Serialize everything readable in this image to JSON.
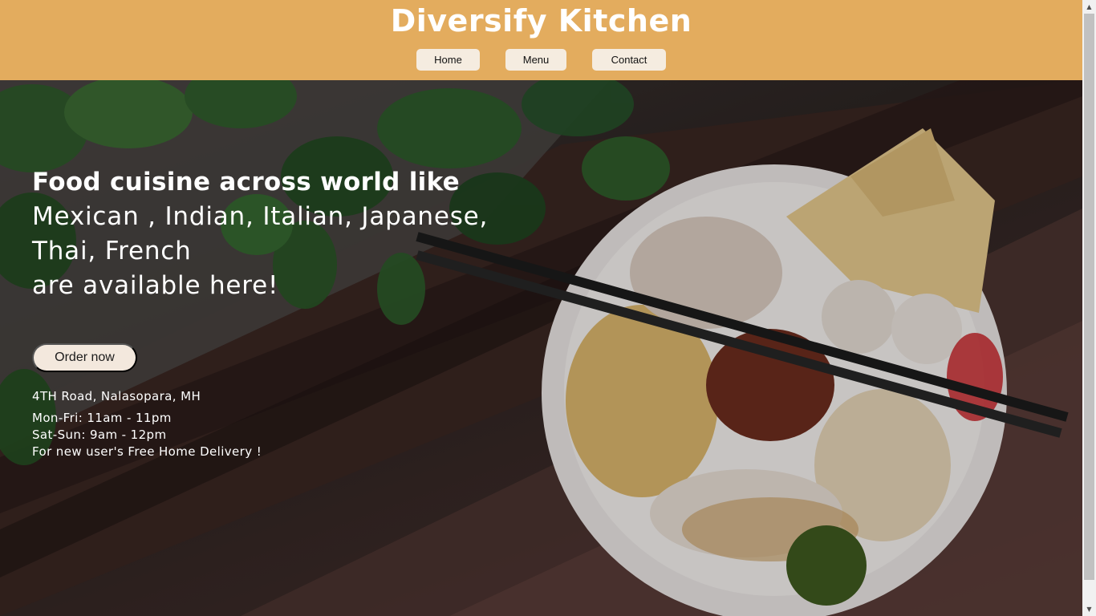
{
  "header": {
    "title": "Diversify Kitchen",
    "nav": [
      {
        "label": "Home"
      },
      {
        "label": "Menu"
      },
      {
        "label": "Contact"
      }
    ],
    "background_color": "#e3ac5e"
  },
  "hero": {
    "headline_bold": "Food cuisine across world like",
    "headline_line2": "Mexican , Indian, Italian, Japanese,",
    "headline_line3": "Thai, French",
    "headline_line4": "are available here!",
    "order_button": "Order now",
    "address": "4TH Road, Nalasopara, MH",
    "hours_weekday": "Mon-Fri: 11am - 11pm",
    "hours_weekend": "Sat-Sun: 9am - 12pm",
    "promo": "For new user's Free Home Delivery !",
    "background_image": "food-bowl-with-chopsticks-on-wooden-table"
  },
  "scrollbar": {
    "up_icon": "chevron-up-icon",
    "down_icon": "chevron-down-icon"
  }
}
